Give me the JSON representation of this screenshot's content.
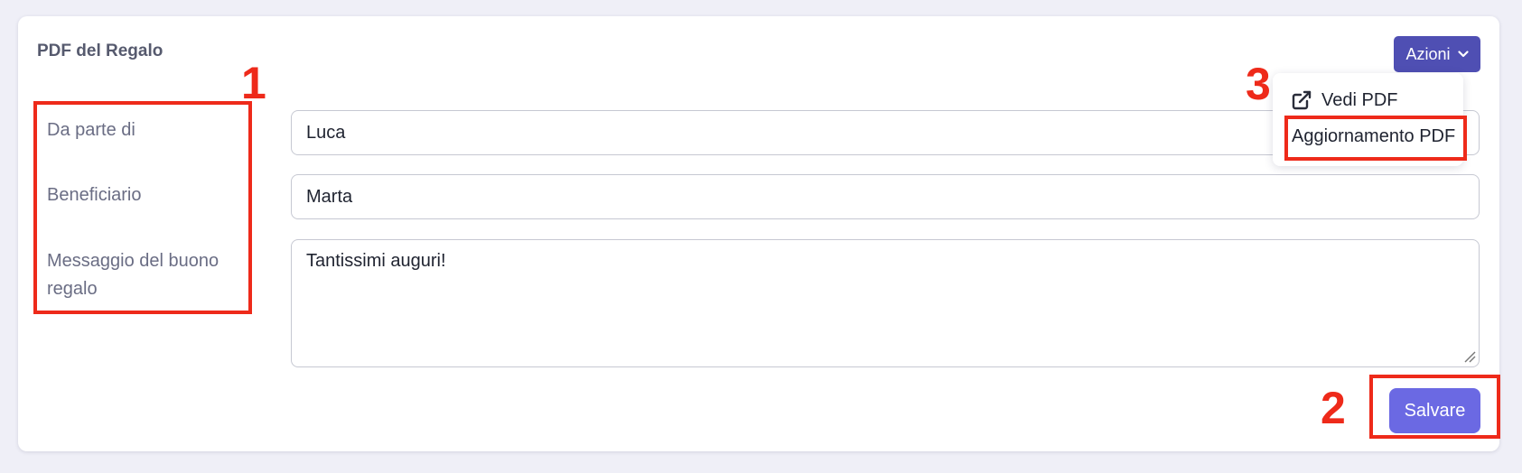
{
  "card": {
    "title": "PDF del Regalo"
  },
  "actions": {
    "dropdown_label": "Azioni",
    "menu": [
      {
        "label": "Vedi PDF",
        "icon": "external-link-icon"
      },
      {
        "label": "Aggiornamento PDF"
      }
    ]
  },
  "form": {
    "from_label": "Da parte di",
    "from_value": "Luca",
    "recipient_label": "Beneficiario",
    "recipient_value": "Marta",
    "message_label_line1": "Messaggio del buono",
    "message_label_line2": "regalo",
    "message_value": "Tantissimi auguri!",
    "save_label": "Salvare"
  },
  "annotations": {
    "n1": "1",
    "n2": "2",
    "n3": "3"
  },
  "colors": {
    "annotation": "#ee2a1a",
    "primary_button": "#6b69e3",
    "dropdown_button": "#4f4fb3",
    "background": "#efeff7"
  }
}
